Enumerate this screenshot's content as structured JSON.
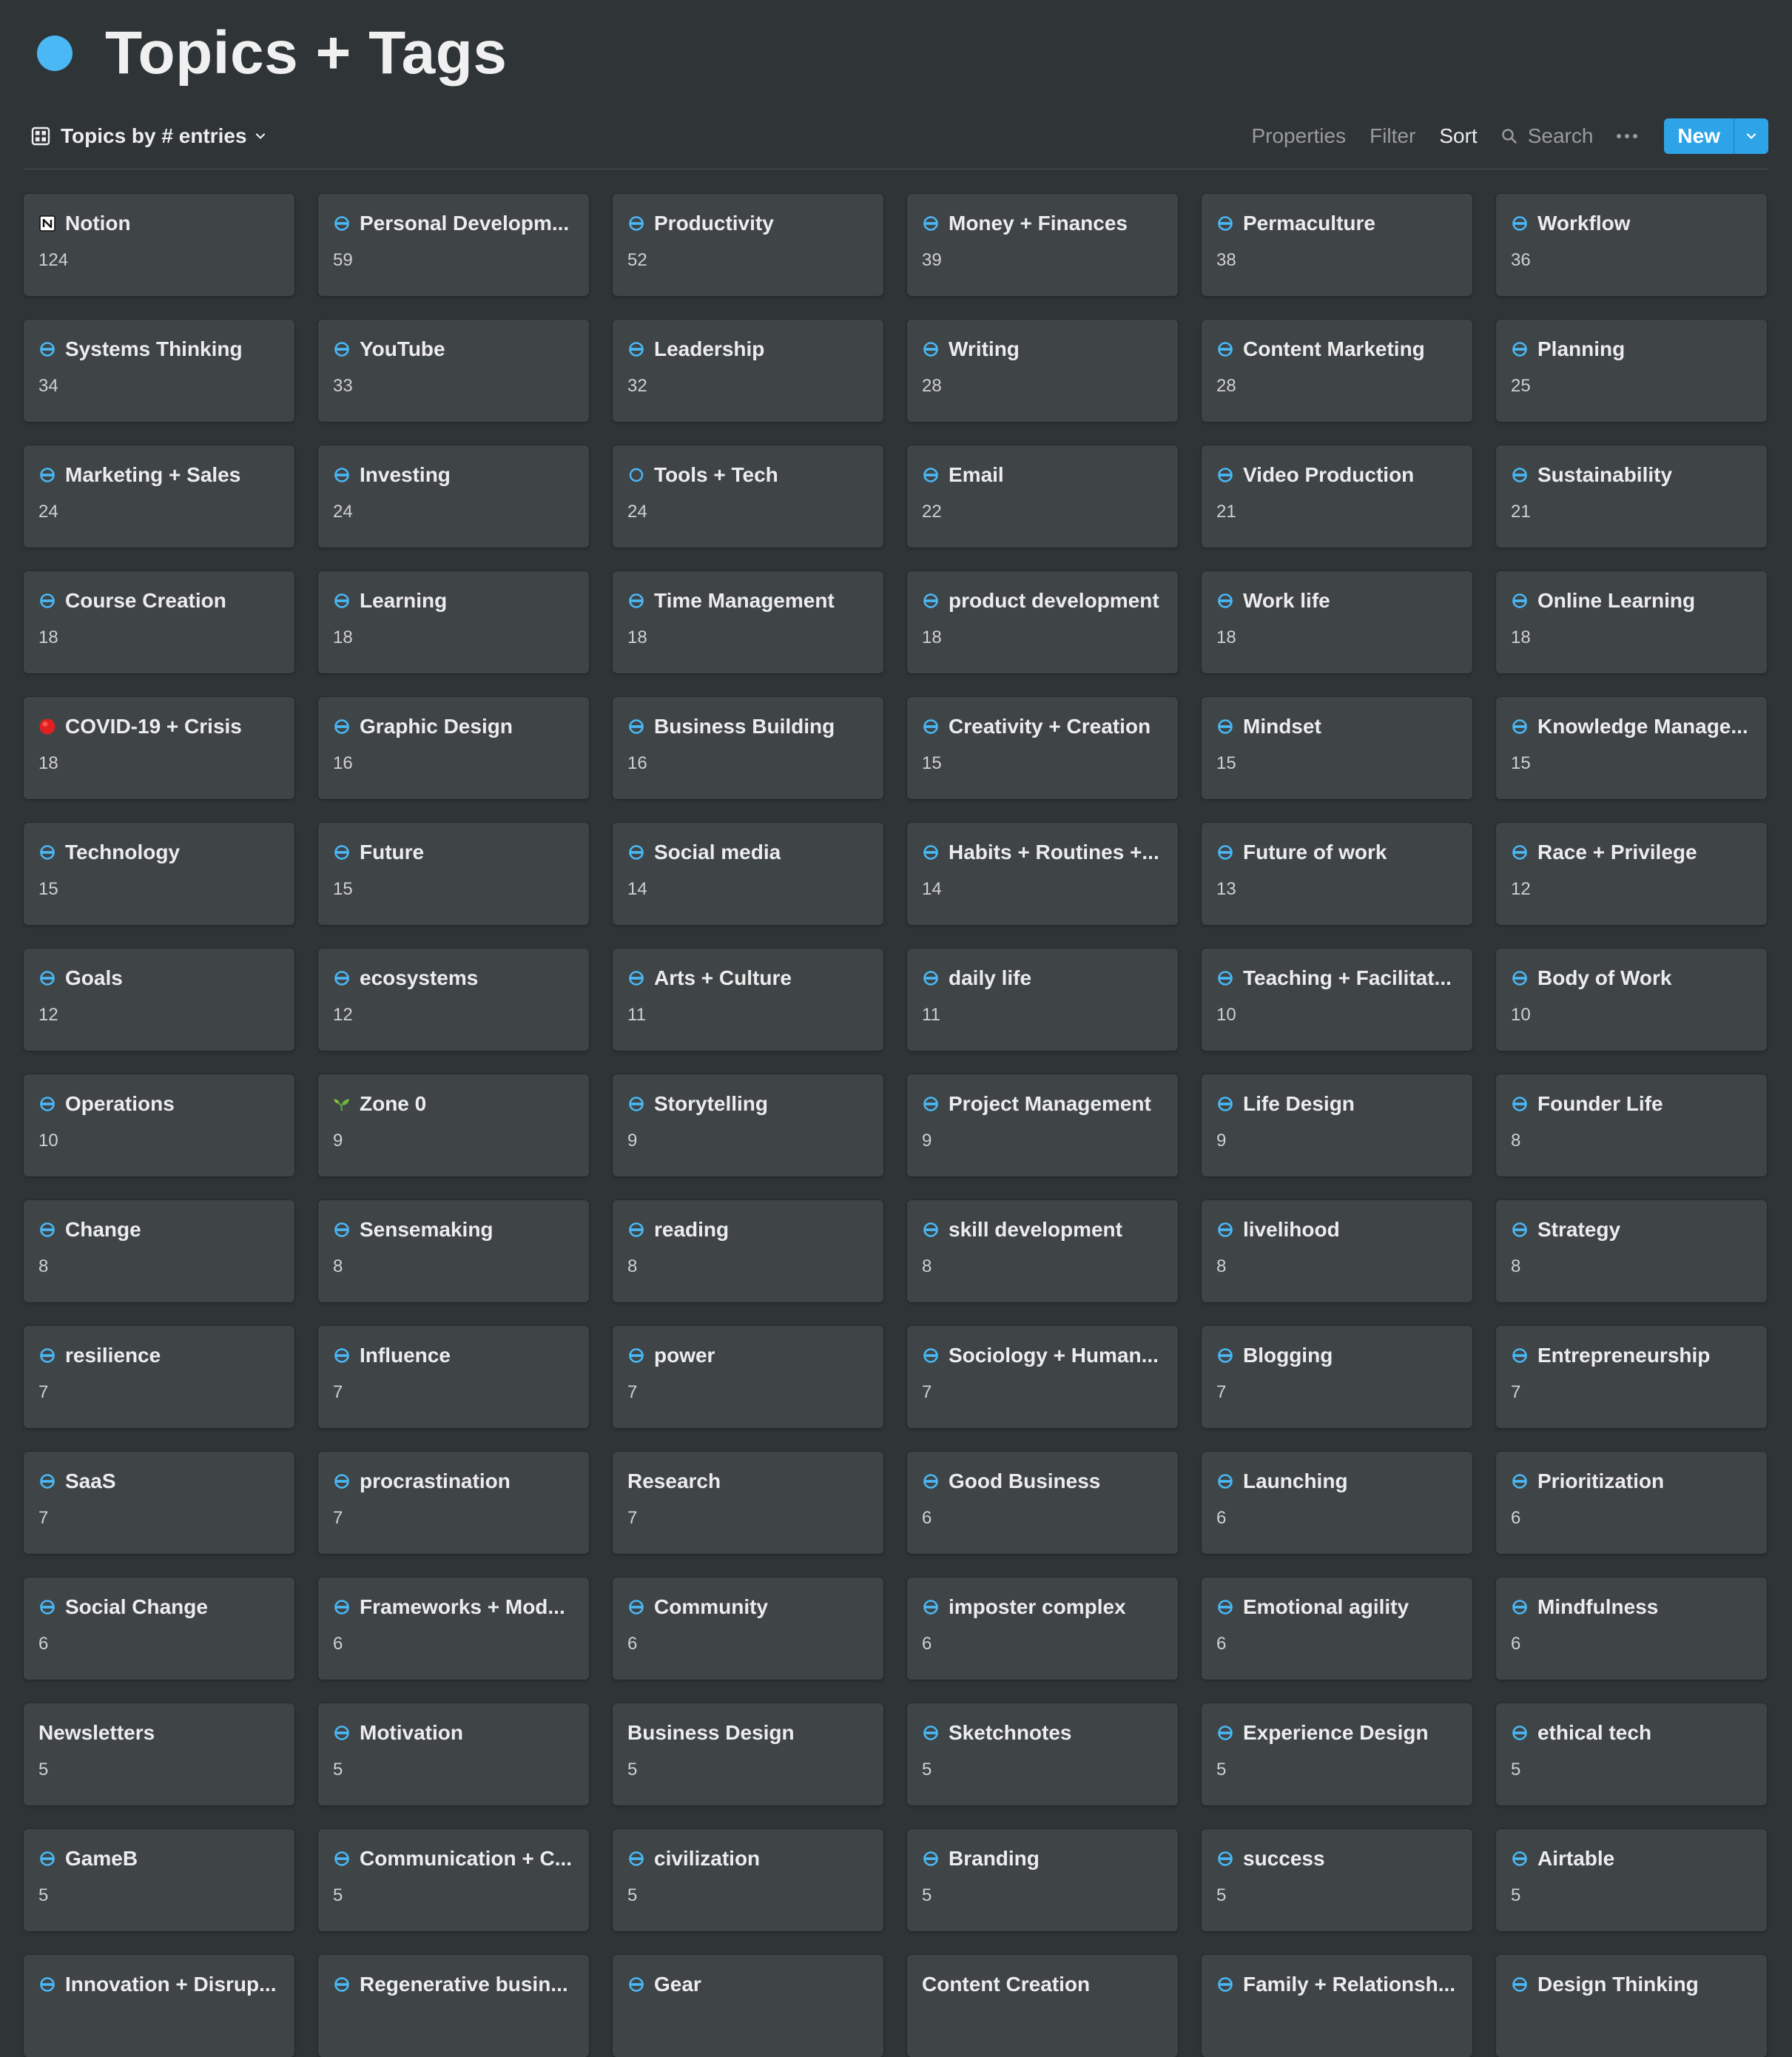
{
  "page": {
    "title": "Topics + Tags",
    "icon": "blue-circle-icon",
    "icon_color": "#4ab8f5"
  },
  "toolbar": {
    "view_name": "Topics by # entries",
    "properties": "Properties",
    "filter": "Filter",
    "sort": "Sort",
    "search": "Search",
    "new": "New"
  },
  "colors": {
    "background": "#2f3437",
    "card": "#3f4447",
    "accent": "#2ea4e8"
  },
  "cards": [
    {
      "title": "Notion",
      "count": "124",
      "icon": "notion-icon"
    },
    {
      "title": "Personal Developm...",
      "count": "59",
      "icon": "tag-icon"
    },
    {
      "title": "Productivity",
      "count": "52",
      "icon": "tag-icon"
    },
    {
      "title": "Money + Finances",
      "count": "39",
      "icon": "tag-icon"
    },
    {
      "title": "Permaculture",
      "count": "38",
      "icon": "tag-icon"
    },
    {
      "title": "Workflow",
      "count": "36",
      "icon": "tag-icon"
    },
    {
      "title": "Systems Thinking",
      "count": "34",
      "icon": "tag-icon"
    },
    {
      "title": "YouTube",
      "count": "33",
      "icon": "tag-icon"
    },
    {
      "title": "Leadership",
      "count": "32",
      "icon": "tag-icon"
    },
    {
      "title": "Writing",
      "count": "28",
      "icon": "tag-icon"
    },
    {
      "title": "Content Marketing",
      "count": "28",
      "icon": "tag-icon"
    },
    {
      "title": "Planning",
      "count": "25",
      "icon": "tag-icon"
    },
    {
      "title": "Marketing + Sales",
      "count": "24",
      "icon": "tag-icon"
    },
    {
      "title": "Investing",
      "count": "24",
      "icon": "tag-icon"
    },
    {
      "title": "Tools + Tech",
      "count": "24",
      "icon": "empty-circle-icon"
    },
    {
      "title": "Email",
      "count": "22",
      "icon": "tag-icon"
    },
    {
      "title": "Video Production",
      "count": "21",
      "icon": "tag-icon"
    },
    {
      "title": "Sustainability",
      "count": "21",
      "icon": "tag-icon"
    },
    {
      "title": "Course Creation",
      "count": "18",
      "icon": "tag-icon"
    },
    {
      "title": "Learning",
      "count": "18",
      "icon": "tag-icon"
    },
    {
      "title": "Time Management",
      "count": "18",
      "icon": "tag-icon"
    },
    {
      "title": "product development",
      "count": "18",
      "icon": "tag-icon"
    },
    {
      "title": "Work life",
      "count": "18",
      "icon": "tag-icon"
    },
    {
      "title": "Online Learning",
      "count": "18",
      "icon": "tag-icon"
    },
    {
      "title": "COVID-19 + Crisis",
      "count": "18",
      "icon": "red-circle-icon"
    },
    {
      "title": "Graphic Design",
      "count": "16",
      "icon": "tag-icon"
    },
    {
      "title": "Business Building",
      "count": "16",
      "icon": "tag-icon"
    },
    {
      "title": "Creativity + Creation",
      "count": "15",
      "icon": "tag-icon"
    },
    {
      "title": "Mindset",
      "count": "15",
      "icon": "tag-icon"
    },
    {
      "title": "Knowledge Manage...",
      "count": "15",
      "icon": "tag-icon"
    },
    {
      "title": "Technology",
      "count": "15",
      "icon": "tag-icon"
    },
    {
      "title": "Future",
      "count": "15",
      "icon": "tag-icon"
    },
    {
      "title": "Social media",
      "count": "14",
      "icon": "tag-icon"
    },
    {
      "title": "Habits + Routines +...",
      "count": "14",
      "icon": "tag-icon"
    },
    {
      "title": "Future of work",
      "count": "13",
      "icon": "tag-icon"
    },
    {
      "title": "Race + Privilege",
      "count": "12",
      "icon": "tag-icon"
    },
    {
      "title": "Goals",
      "count": "12",
      "icon": "tag-icon"
    },
    {
      "title": "ecosystems",
      "count": "12",
      "icon": "tag-icon"
    },
    {
      "title": "Arts + Culture",
      "count": "11",
      "icon": "tag-icon"
    },
    {
      "title": "daily life",
      "count": "11",
      "icon": "tag-icon"
    },
    {
      "title": "Teaching + Facilitat...",
      "count": "10",
      "icon": "tag-icon"
    },
    {
      "title": "Body of Work",
      "count": "10",
      "icon": "tag-icon"
    },
    {
      "title": "Operations",
      "count": "10",
      "icon": "tag-icon"
    },
    {
      "title": "Zone 0",
      "count": "9",
      "icon": "seedling-icon"
    },
    {
      "title": "Storytelling",
      "count": "9",
      "icon": "tag-icon"
    },
    {
      "title": "Project Management",
      "count": "9",
      "icon": "tag-icon"
    },
    {
      "title": "Life Design",
      "count": "9",
      "icon": "tag-icon"
    },
    {
      "title": "Founder Life",
      "count": "8",
      "icon": "tag-icon"
    },
    {
      "title": "Change",
      "count": "8",
      "icon": "tag-icon"
    },
    {
      "title": "Sensemaking",
      "count": "8",
      "icon": "tag-icon"
    },
    {
      "title": "reading",
      "count": "8",
      "icon": "tag-icon"
    },
    {
      "title": "skill development",
      "count": "8",
      "icon": "tag-icon"
    },
    {
      "title": "livelihood",
      "count": "8",
      "icon": "tag-icon"
    },
    {
      "title": "Strategy",
      "count": "8",
      "icon": "tag-icon"
    },
    {
      "title": "resilience",
      "count": "7",
      "icon": "tag-icon"
    },
    {
      "title": "Influence",
      "count": "7",
      "icon": "tag-icon"
    },
    {
      "title": "power",
      "count": "7",
      "icon": "tag-icon"
    },
    {
      "title": "Sociology + Human...",
      "count": "7",
      "icon": "tag-icon"
    },
    {
      "title": "Blogging",
      "count": "7",
      "icon": "tag-icon"
    },
    {
      "title": "Entrepreneurship",
      "count": "7",
      "icon": "tag-icon"
    },
    {
      "title": "SaaS",
      "count": "7",
      "icon": "tag-icon"
    },
    {
      "title": "procrastination",
      "count": "7",
      "icon": "tag-icon"
    },
    {
      "title": "Research",
      "count": "7",
      "icon": ""
    },
    {
      "title": "Good Business",
      "count": "6",
      "icon": "tag-icon"
    },
    {
      "title": "Launching",
      "count": "6",
      "icon": "tag-icon"
    },
    {
      "title": "Prioritization",
      "count": "6",
      "icon": "tag-icon"
    },
    {
      "title": "Social Change",
      "count": "6",
      "icon": "tag-icon"
    },
    {
      "title": "Frameworks + Mod...",
      "count": "6",
      "icon": "tag-icon"
    },
    {
      "title": "Community",
      "count": "6",
      "icon": "tag-icon"
    },
    {
      "title": "imposter complex",
      "count": "6",
      "icon": "tag-icon"
    },
    {
      "title": "Emotional agility",
      "count": "6",
      "icon": "tag-icon"
    },
    {
      "title": "Mindfulness",
      "count": "6",
      "icon": "tag-icon"
    },
    {
      "title": "Newsletters",
      "count": "5",
      "icon": ""
    },
    {
      "title": "Motivation",
      "count": "5",
      "icon": "tag-icon"
    },
    {
      "title": "Business Design",
      "count": "5",
      "icon": ""
    },
    {
      "title": "Sketchnotes",
      "count": "5",
      "icon": "tag-icon"
    },
    {
      "title": "Experience Design",
      "count": "5",
      "icon": "tag-icon"
    },
    {
      "title": "ethical tech",
      "count": "5",
      "icon": "tag-icon"
    },
    {
      "title": "GameB",
      "count": "5",
      "icon": "tag-icon"
    },
    {
      "title": "Communication + C...",
      "count": "5",
      "icon": "tag-icon"
    },
    {
      "title": "civilization",
      "count": "5",
      "icon": "tag-icon"
    },
    {
      "title": "Branding",
      "count": "5",
      "icon": "tag-icon"
    },
    {
      "title": "success",
      "count": "5",
      "icon": "tag-icon"
    },
    {
      "title": "Airtable",
      "count": "5",
      "icon": "tag-icon"
    },
    {
      "title": "Innovation + Disrup...",
      "count": "",
      "icon": "tag-icon"
    },
    {
      "title": "Regenerative busin...",
      "count": "",
      "icon": "tag-icon"
    },
    {
      "title": "Gear",
      "count": "",
      "icon": "tag-icon"
    },
    {
      "title": "Content Creation",
      "count": "",
      "icon": ""
    },
    {
      "title": "Family + Relationsh...",
      "count": "",
      "icon": "tag-icon"
    },
    {
      "title": "Design Thinking",
      "count": "",
      "icon": "tag-icon"
    }
  ]
}
